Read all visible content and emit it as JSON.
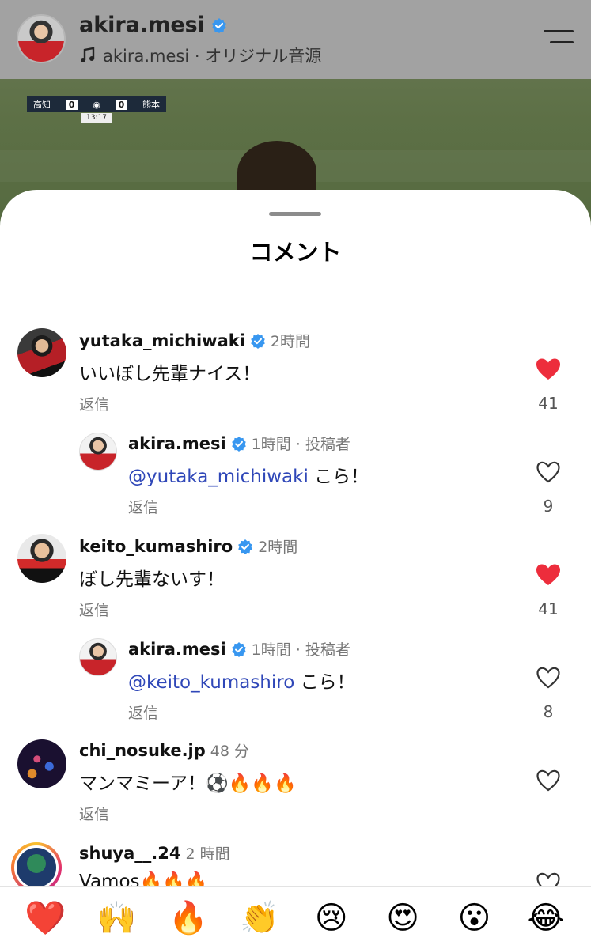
{
  "header": {
    "username": "akira.mesi",
    "audio": "akira.mesi · オリジナル音源"
  },
  "video": {
    "scoreboard": {
      "home": "高知",
      "home_score": "0",
      "away_score": "0",
      "away": "熊本",
      "time": "13:17"
    }
  },
  "sheet": {
    "title": "コメント"
  },
  "comments": [
    {
      "user": "yutaka_michiwaki",
      "time": "2時間",
      "text": "いいぼし先輩ナイス！",
      "reply": "返信",
      "likes": "41",
      "liked": true
    },
    {
      "user": "akira.mesi",
      "time": "1時間 · 投稿者",
      "mention": "@yutaka_michiwaki",
      "text": "こら！",
      "reply": "返信",
      "likes": "9",
      "liked": false
    },
    {
      "user": "keito_kumashiro",
      "time": "2時間",
      "text": "ぼし先輩ないす！",
      "reply": "返信",
      "likes": "41",
      "liked": true
    },
    {
      "user": "akira.mesi",
      "time": "1時間 · 投稿者",
      "mention": "@keito_kumashiro",
      "text": "こら！",
      "reply": "返信",
      "likes": "8",
      "liked": false
    },
    {
      "user": "chi_nosuke.jp",
      "time": "48 分",
      "text": "マンマミーア！⚽🔥🔥🔥",
      "reply": "返信",
      "liked": false
    },
    {
      "user": "shuya__.24",
      "time": "2 時間",
      "text": "Vamos🔥🔥🔥",
      "liked": false
    }
  ],
  "emoji_bar": [
    "❤️",
    "🙌",
    "🔥",
    "👏",
    "😢",
    "😍",
    "😮",
    "😂"
  ],
  "colors": {
    "like_red": "#ed2d3c",
    "mention_blue": "#2f47b8",
    "verified_blue": "#3897f0"
  },
  "icons": [
    "music-note-icon",
    "verified-icon",
    "menu-icon",
    "heart-filled-icon",
    "heart-outline-icon"
  ]
}
